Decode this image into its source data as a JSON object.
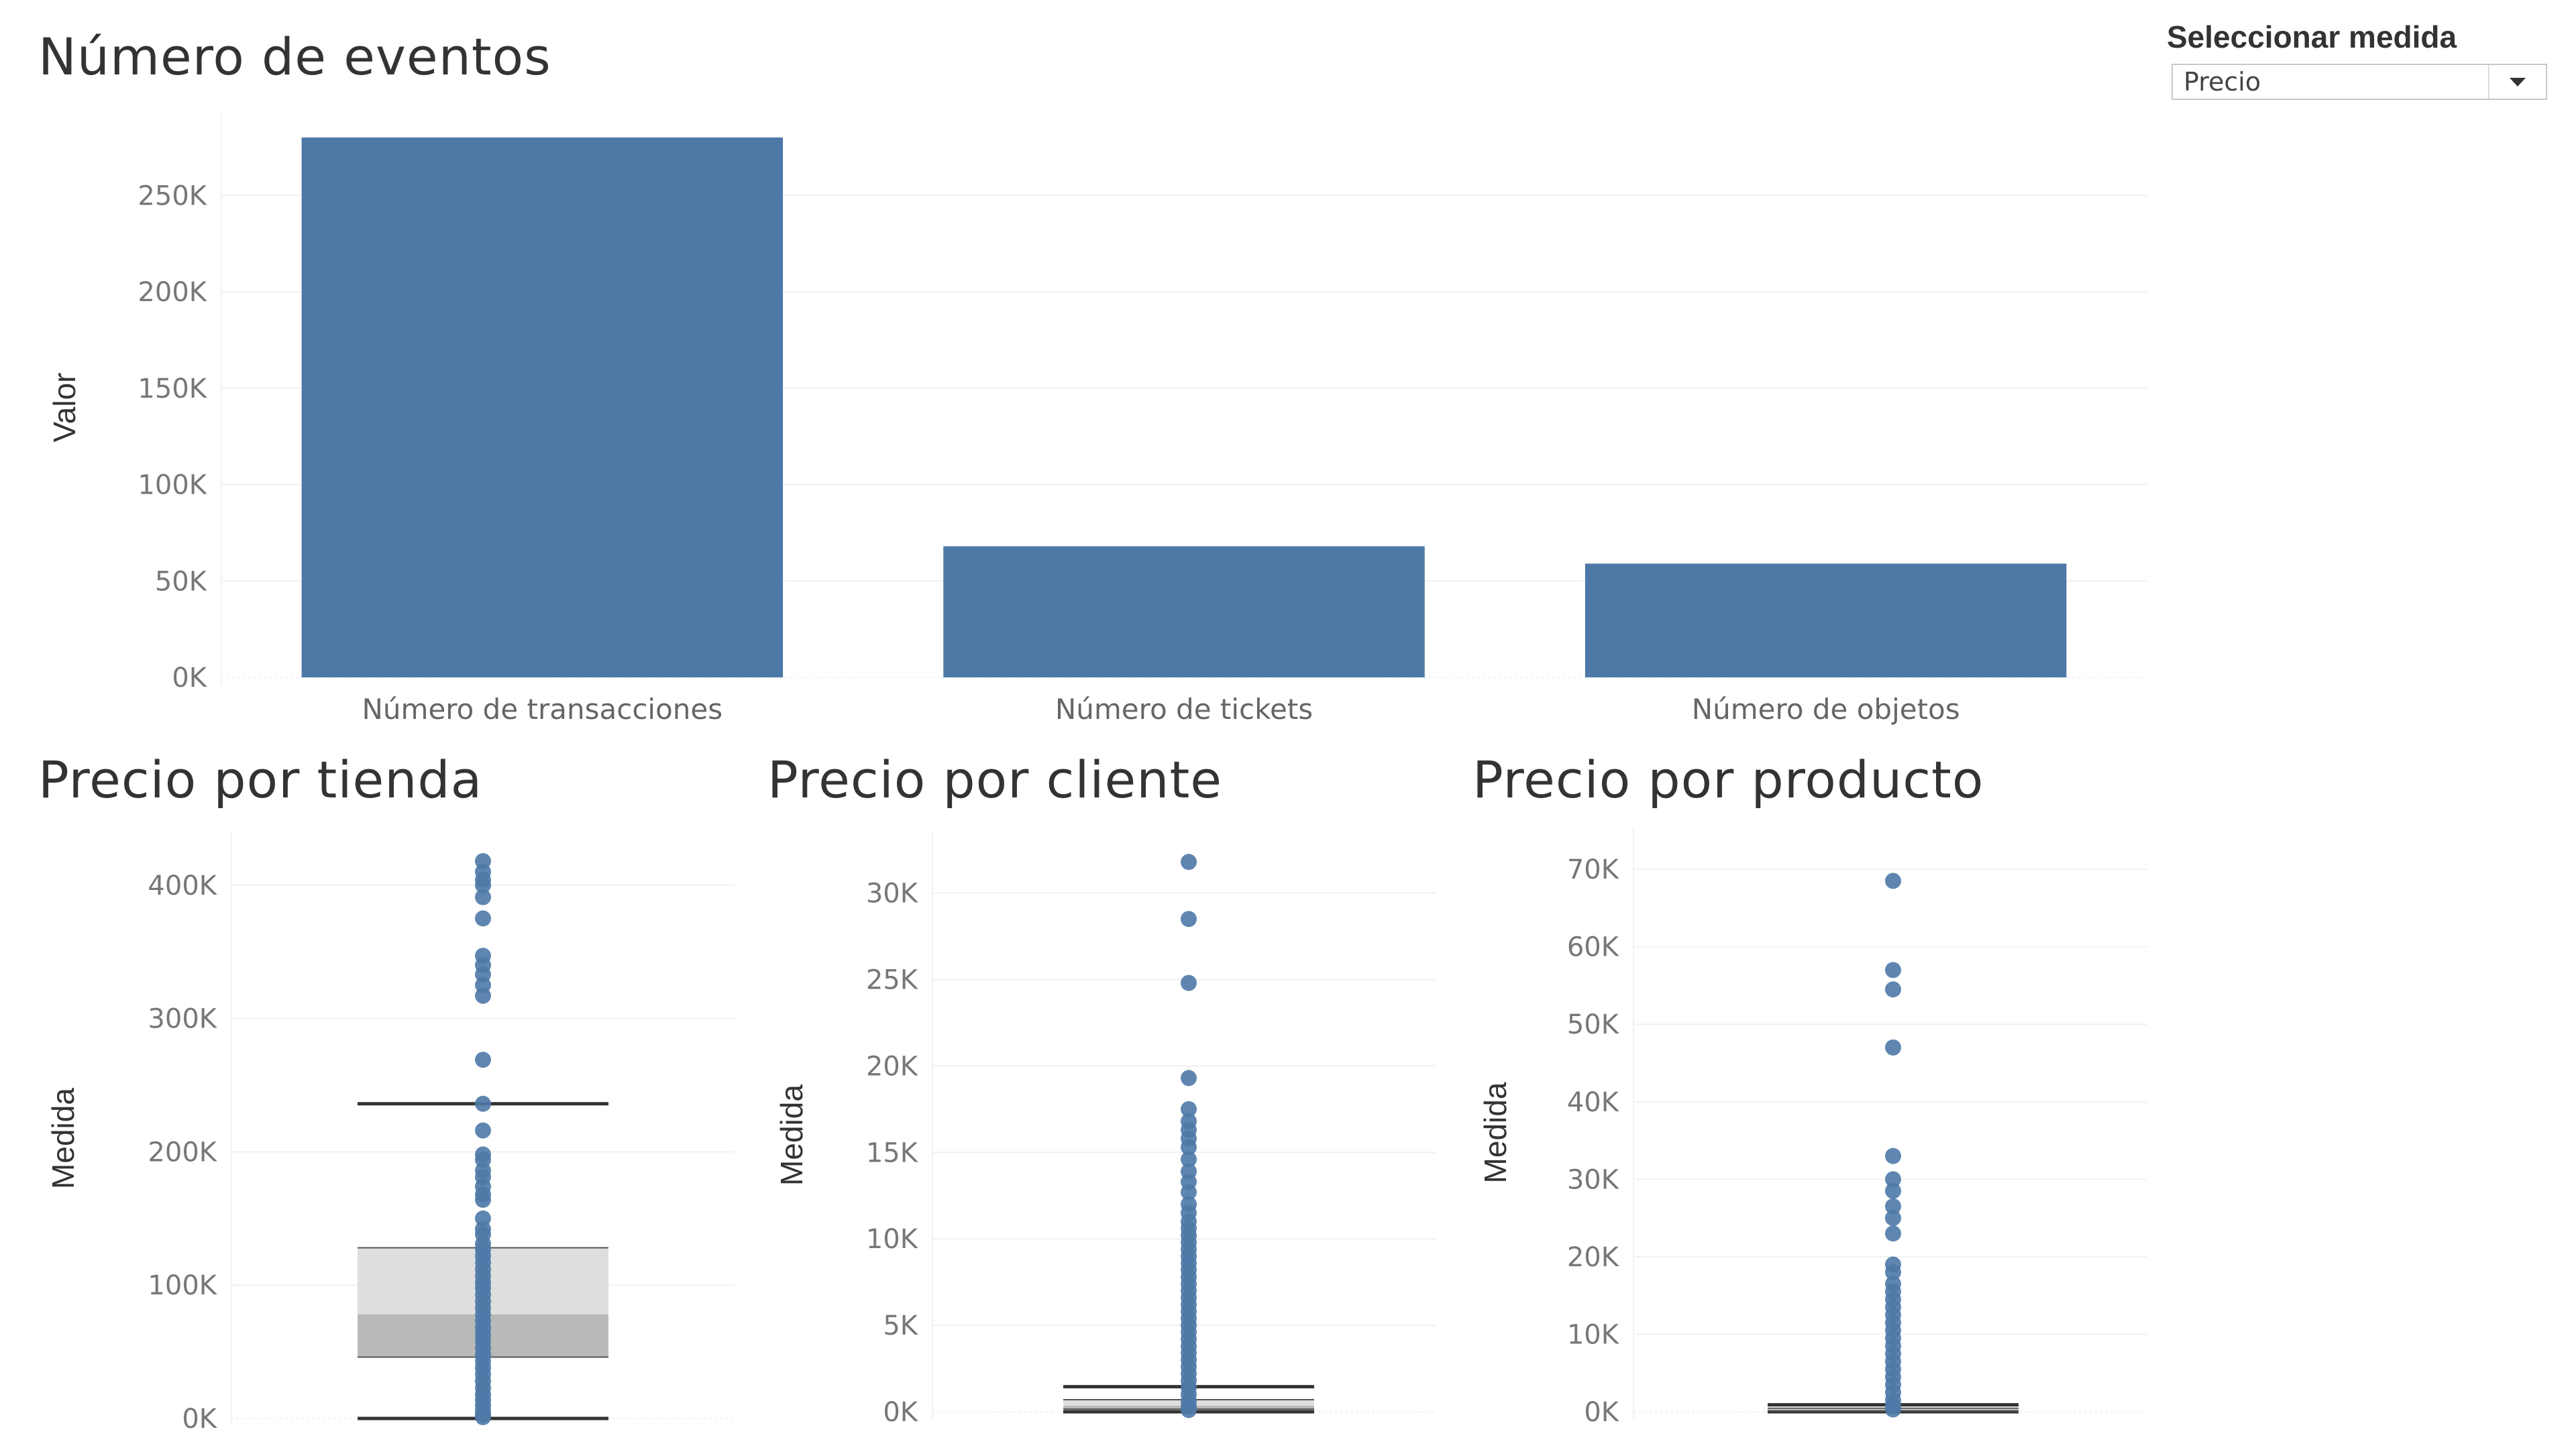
{
  "selector": {
    "label": "Seleccionar medida",
    "value": "Precio"
  },
  "colors": {
    "bar": "#4e79a7",
    "point": "#4e79a7",
    "box_upper": "#dedede",
    "box_lower": "#b9b9b9",
    "whisker": "#333333",
    "grid": "#f0f0f0"
  },
  "chart_data": [
    {
      "type": "bar",
      "title": "Número de eventos",
      "ylabel": "Valor",
      "ylim": [
        0,
        280000
      ],
      "yticks": [
        0,
        50000,
        100000,
        150000,
        200000,
        250000
      ],
      "ytick_labels": [
        "0K",
        "50K",
        "100K",
        "150K",
        "200K",
        "250K"
      ],
      "categories": [
        "Número de transacciones",
        "Número de tickets",
        "Número de objetos"
      ],
      "values": [
        280000,
        68000,
        59000
      ]
    },
    {
      "type": "scatter",
      "title": "Precio por tienda",
      "ylabel": "Medida",
      "ylim": [
        0,
        420000
      ],
      "yticks": [
        0,
        100000,
        200000,
        300000,
        400000
      ],
      "ytick_labels": [
        "0K",
        "100K",
        "200K",
        "300K",
        "400K"
      ],
      "box": {
        "whisker_low": 0,
        "q1": 46000,
        "median": 78000,
        "q3": 128000,
        "whisker_high": 236000
      },
      "values": [
        418000,
        410000,
        404000,
        400000,
        391000,
        375000,
        347000,
        340000,
        333000,
        325000,
        317000,
        269000,
        236000,
        216000,
        198000,
        194000,
        186000,
        181000,
        174000,
        168000,
        164000,
        150000,
        142000,
        138000,
        131000,
        127000,
        122000,
        117000,
        112000,
        107000,
        102000,
        98000,
        93000,
        88000,
        83000,
        78000,
        73000,
        68000,
        63000,
        58000,
        53000,
        48000,
        43000,
        38000,
        33000,
        28000,
        23000,
        18000,
        14000,
        10000,
        6000,
        3000,
        1000
      ]
    },
    {
      "type": "scatter",
      "title": "Precio por cliente",
      "ylabel": "Medida",
      "ylim": [
        0,
        32000
      ],
      "yticks": [
        0,
        5000,
        10000,
        15000,
        20000,
        25000,
        30000
      ],
      "ytick_labels": [
        "0K",
        "5K",
        "10K",
        "15K",
        "20K",
        "25K",
        "30K"
      ],
      "box": {
        "whisker_low": 0,
        "q1": 150,
        "median": 350,
        "q3": 700,
        "whisker_high": 1450
      },
      "values": [
        31800,
        28500,
        24800,
        19300,
        17500,
        16800,
        16300,
        15800,
        15300,
        14600,
        13900,
        13300,
        12700,
        12000,
        11500,
        11000,
        10600,
        10200,
        9800,
        9400,
        9000,
        8600,
        8200,
        7800,
        7400,
        7000,
        6600,
        6200,
        5800,
        5400,
        5000,
        4600,
        4200,
        3800,
        3400,
        3000,
        2600,
        2200,
        1800,
        1400,
        1000,
        600,
        300,
        100
      ]
    },
    {
      "type": "scatter",
      "title": "Precio por producto",
      "ylabel": "Medida",
      "ylim": [
        0,
        72000
      ],
      "yticks": [
        0,
        10000,
        20000,
        30000,
        40000,
        50000,
        60000,
        70000
      ],
      "ytick_labels": [
        "0K",
        "10K",
        "20K",
        "30K",
        "40K",
        "50K",
        "60K",
        "70K"
      ],
      "box": {
        "whisker_low": 0,
        "q1": 100,
        "median": 250,
        "q3": 450,
        "whisker_high": 900
      },
      "values": [
        68500,
        57000,
        54500,
        47000,
        33000,
        30000,
        28500,
        26500,
        25000,
        23000,
        19000,
        18000,
        16500,
        15500,
        14500,
        13500,
        12500,
        11500,
        10500,
        9500,
        8500,
        7500,
        6500,
        5500,
        4500,
        3500,
        2500,
        1500,
        800,
        300
      ]
    }
  ]
}
